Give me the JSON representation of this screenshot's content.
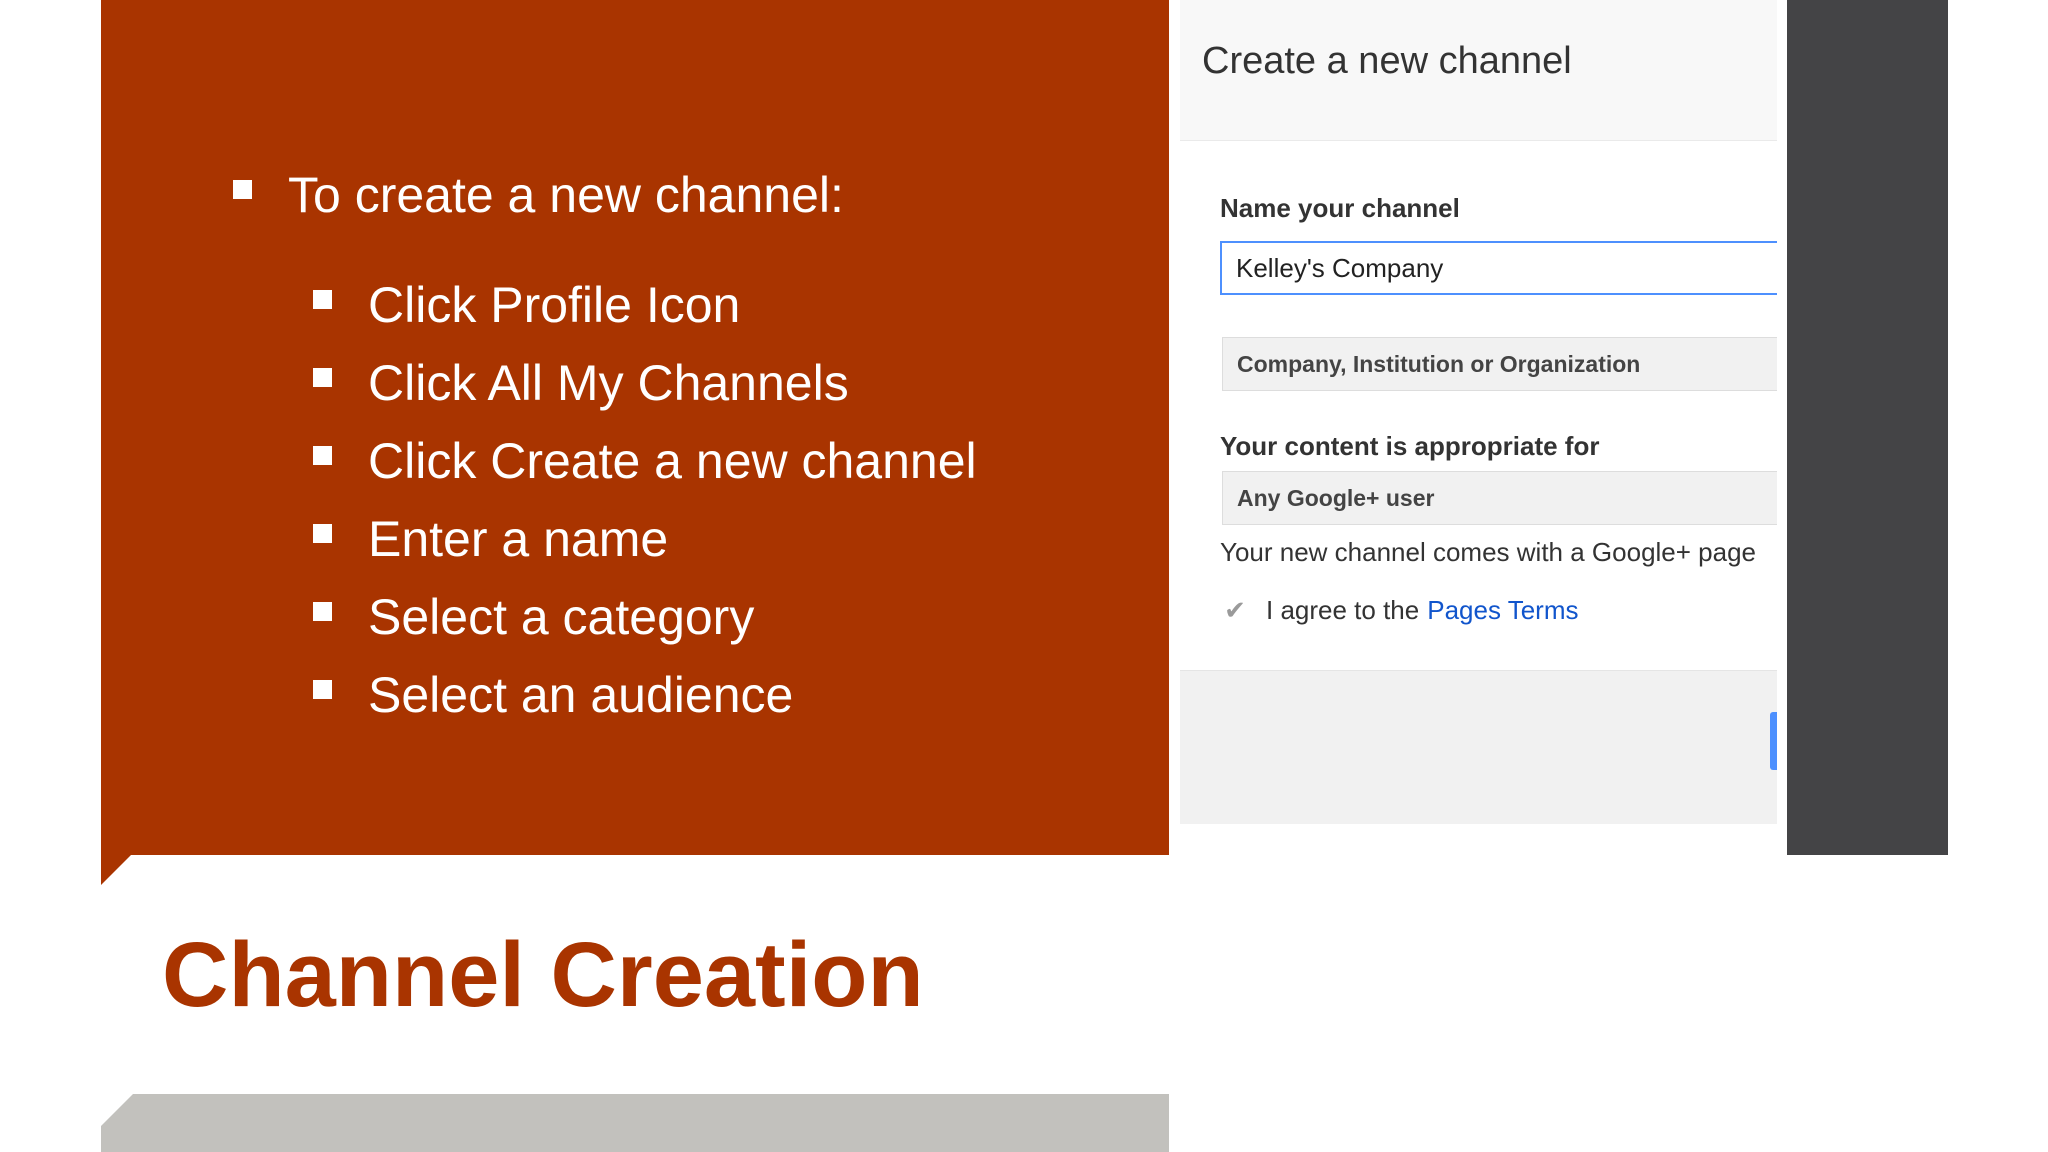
{
  "slide": {
    "title": "Channel Creation",
    "colors": {
      "accent": "#A93400",
      "dark_panel": "#444446",
      "gray_bar": "#C2C1BD"
    },
    "bullets": {
      "main": "To create a new channel:",
      "steps": [
        "Click Profile Icon",
        "Click All My Channels",
        "Click Create a new channel",
        "Enter a name",
        "Select a category",
        "Select an audience"
      ]
    }
  },
  "dialog": {
    "title": "Create a new channel",
    "name_label": "Name your channel",
    "name_value": "Kelley's Company",
    "category_value": "Company, Institution or Organization",
    "audience_label": "Your content is appropriate for",
    "audience_value": "Any Google+ user",
    "note": "Your new channel comes with a Google+ page",
    "agree_text": "I agree to the",
    "agree_link": "Pages Terms",
    "checkbox_icon": "checkmark-icon",
    "colors": {
      "link": "#1155CC",
      "focus": "#4D90FE"
    }
  }
}
